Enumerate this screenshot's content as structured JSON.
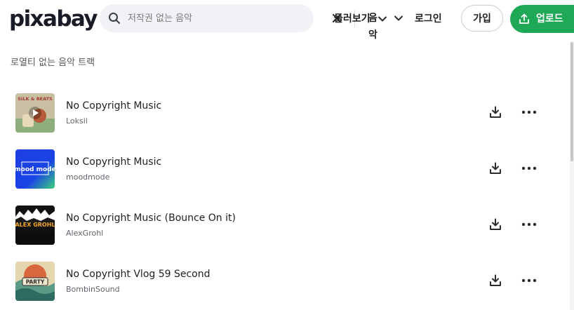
{
  "header": {
    "logo": "pixabay",
    "search": {
      "placeholder": "저작권 없는 음악",
      "value": ""
    },
    "category": "음악",
    "explore": "둘러보기",
    "login": "로그인",
    "signup": "가입",
    "upload": "업로드"
  },
  "section_title": "로열티 없는 음악 트랙",
  "tracks": [
    {
      "title": "No Copyright Music",
      "artist": "Loksii",
      "thumb_text": "SILK & BEATS"
    },
    {
      "title": "No Copyright Music",
      "artist": "moodmode",
      "thumb_text": "mood mode"
    },
    {
      "title": "No Copyright Music (Bounce On it)",
      "artist": "AlexGrohl",
      "thumb_text": "ALEX GROHL"
    },
    {
      "title": "No Copyright Vlog 59 Second",
      "artist": "BombinSound",
      "thumb_text": "PARTY"
    }
  ],
  "colors": {
    "upload_bg": "#1fa855",
    "text": "#1f1f1f",
    "muted": "#60656b"
  }
}
